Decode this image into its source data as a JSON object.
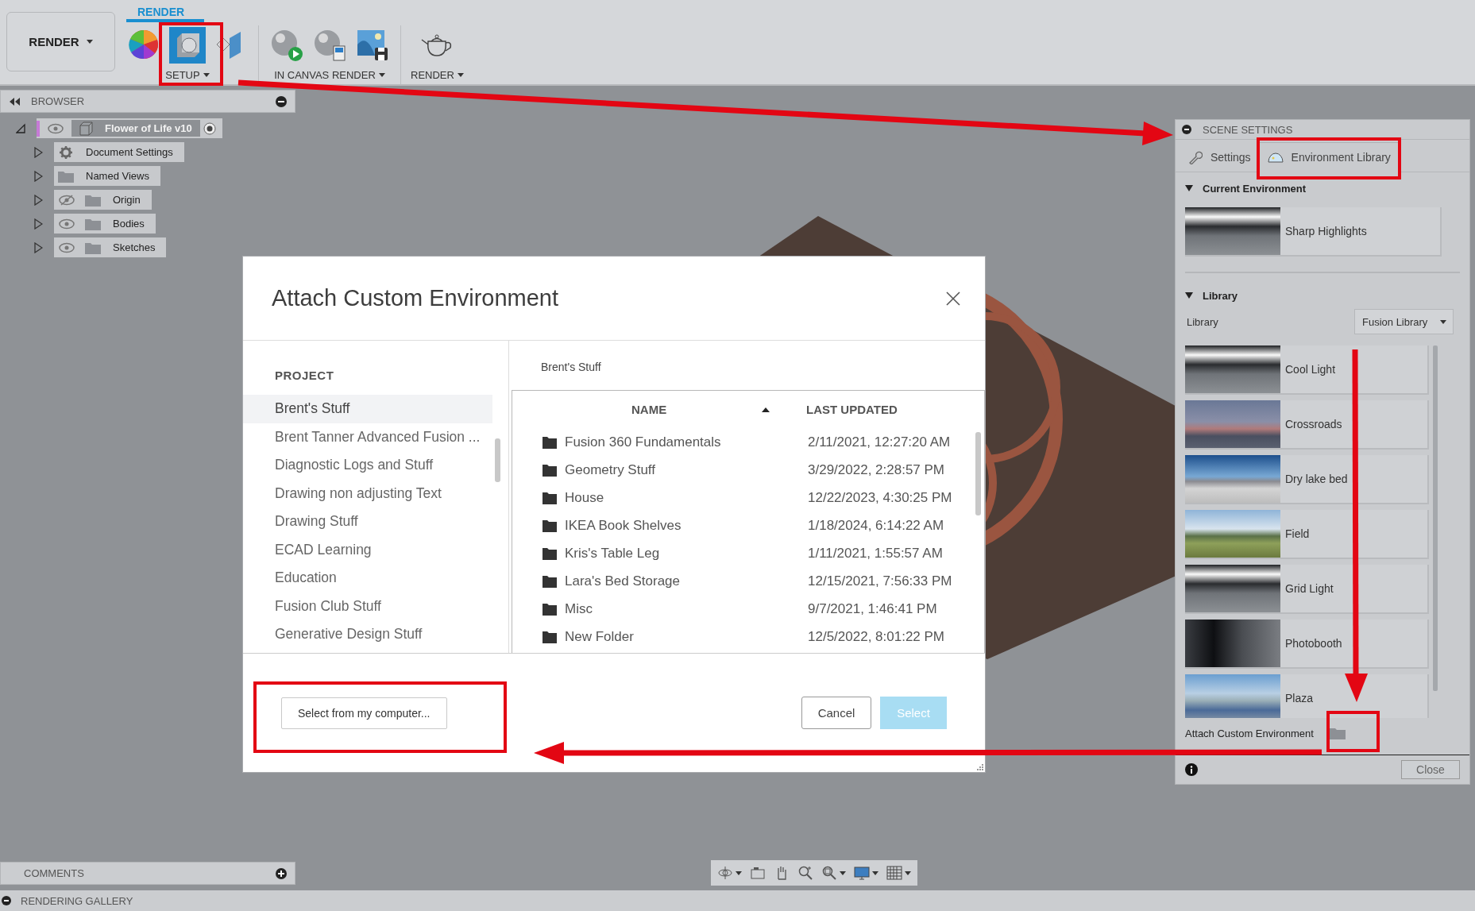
{
  "toolbar": {
    "workspace_button": "RENDER",
    "tab": {
      "label": "RENDER",
      "selected": true
    },
    "groups": [
      {
        "label": "SETUP",
        "tools": [
          {
            "kind": "appearance",
            "active": false
          },
          {
            "kind": "scene-settings",
            "active": true
          },
          {
            "kind": "texture-map",
            "active": false
          }
        ]
      },
      {
        "label": "IN CANVAS RENDER",
        "tools": [
          {
            "kind": "render-start",
            "active": false
          },
          {
            "kind": "render-settings",
            "active": false
          },
          {
            "kind": "capture-image",
            "active": false
          }
        ]
      },
      {
        "label": "RENDER",
        "tools": [
          {
            "kind": "teapot",
            "active": false
          }
        ]
      }
    ]
  },
  "browser": {
    "title": "BROWSER",
    "root": {
      "label": "Flower of Life v10",
      "expanded": true,
      "visible": true,
      "children": [
        {
          "label": "Document Settings",
          "kind": "settings",
          "visible": true,
          "expanded": false
        },
        {
          "label": "Named Views",
          "kind": "views",
          "visible": true,
          "expanded": false
        },
        {
          "label": "Origin",
          "kind": "folder",
          "visible": false,
          "expanded": false
        },
        {
          "label": "Bodies",
          "kind": "folder",
          "visible": true,
          "expanded": false
        },
        {
          "label": "Sketches",
          "kind": "folder",
          "visible": true,
          "expanded": false
        }
      ]
    }
  },
  "dialog": {
    "title": "Attach Custom Environment",
    "projects_heading": "PROJECT",
    "projects": [
      {
        "label": "Brent's Stuff",
        "selected": true
      },
      {
        "label": "Brent Tanner Advanced Fusion ...",
        "selected": false
      },
      {
        "label": "Diagnostic Logs and Stuff",
        "selected": false
      },
      {
        "label": "Drawing non adjusting Text",
        "selected": false
      },
      {
        "label": "Drawing Stuff",
        "selected": false
      },
      {
        "label": "ECAD Learning",
        "selected": false
      },
      {
        "label": "Education",
        "selected": false
      },
      {
        "label": "Fusion Club Stuff",
        "selected": false
      },
      {
        "label": "Generative Design Stuff",
        "selected": false
      }
    ],
    "breadcrumb": "Brent's Stuff",
    "columns": [
      {
        "label": "NAME",
        "sorted": true
      },
      {
        "label": "LAST UPDATED",
        "sorted": false
      }
    ],
    "rows": [
      {
        "name": "Fusion 360 Fundamentals",
        "updated": "2/11/2021, 12:27:20 AM"
      },
      {
        "name": "Geometry Stuff",
        "updated": "3/29/2022, 2:28:57 PM"
      },
      {
        "name": "House",
        "updated": "12/22/2023, 4:30:25 PM"
      },
      {
        "name": "IKEA Book Shelves",
        "updated": "1/18/2024, 6:14:22 AM"
      },
      {
        "name": "Kris's Table Leg",
        "updated": "1/11/2021, 1:55:57 AM"
      },
      {
        "name": "Lara's Bed Storage",
        "updated": "12/15/2021, 7:56:33 PM"
      },
      {
        "name": "Misc",
        "updated": "9/7/2021, 1:46:41 PM"
      },
      {
        "name": "New Folder",
        "updated": "12/5/2022, 8:01:22 PM"
      }
    ],
    "local_button": "Select from my computer...",
    "cancel_button": "Cancel",
    "select_button": {
      "label": "Select",
      "disabled": true
    }
  },
  "scene_settings": {
    "title": "SCENE SETTINGS",
    "tabs": [
      {
        "label": "Settings",
        "kind": "wrench",
        "selected": false
      },
      {
        "label": "Environment Library",
        "kind": "dome",
        "selected": true
      }
    ],
    "current": {
      "heading": "Current Environment",
      "expanded": true,
      "environment": {
        "name": "Sharp Highlights",
        "kind": "studio"
      }
    },
    "library": {
      "heading": "Library",
      "expanded": true,
      "field_label": "Library",
      "dropdown": "Fusion Library",
      "environments": [
        {
          "name": "Cool Light",
          "kind": "studio"
        },
        {
          "name": "Crossroads",
          "kind": "dusk"
        },
        {
          "name": "Dry lake bed",
          "kind": "desert"
        },
        {
          "name": "Field",
          "kind": "field"
        },
        {
          "name": "Grid Light",
          "kind": "studio"
        },
        {
          "name": "Photobooth",
          "kind": "dark"
        },
        {
          "name": "Plaza",
          "kind": "plaza"
        }
      ]
    },
    "attach_label": "Attach Custom Environment",
    "close_button": "Close"
  },
  "comments": "COMMENTS",
  "gallery": "RENDERING GALLERY"
}
